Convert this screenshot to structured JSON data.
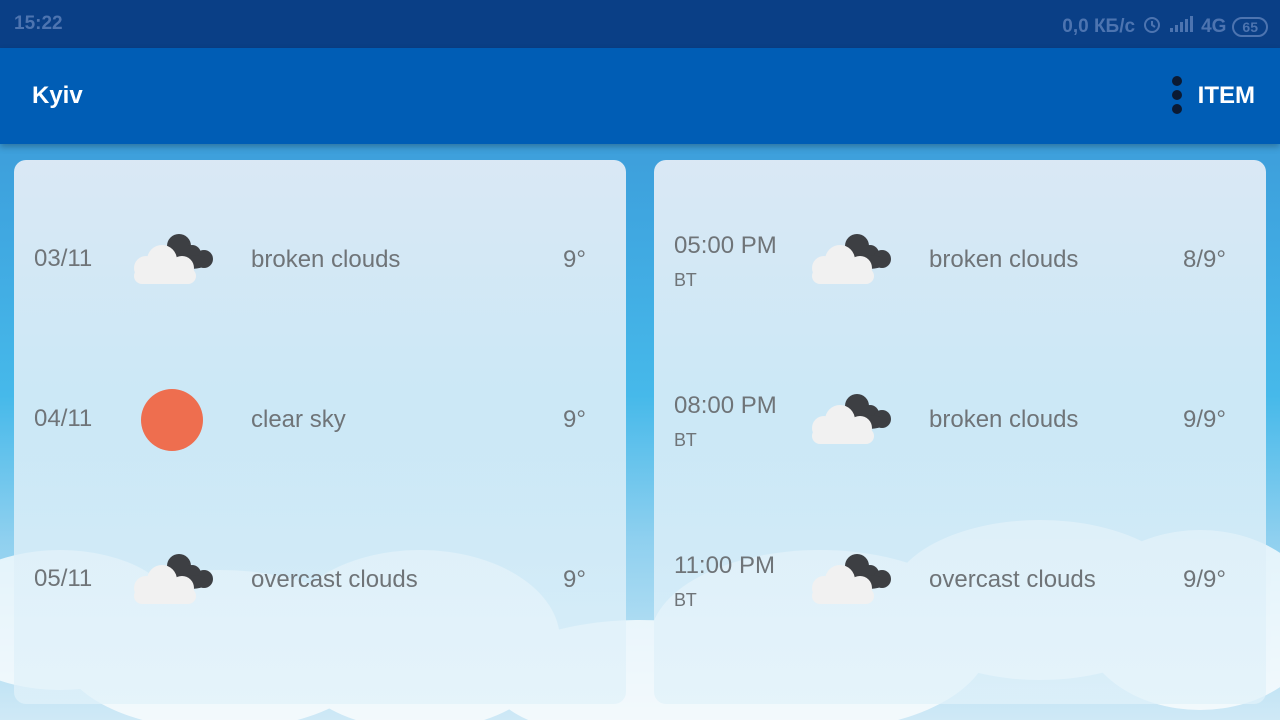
{
  "status_bar": {
    "time": "15:22",
    "net_speed": "0,0 КБ/с",
    "network": "4G",
    "battery": "65"
  },
  "app_bar": {
    "title": "Kyiv",
    "menu_icon": "more-vert-icon",
    "action_label": "ITEM"
  },
  "daily_forecast": [
    {
      "date": "03/11",
      "icon": "broken-clouds-icon",
      "description": "broken clouds",
      "temp": "9°"
    },
    {
      "date": "04/11",
      "icon": "clear-sky-icon",
      "description": "clear sky",
      "temp": "9°"
    },
    {
      "date": "05/11",
      "icon": "overcast-clouds-icon",
      "description": "overcast clouds",
      "temp": "9°"
    }
  ],
  "hourly_forecast": [
    {
      "time": "05:00 PM",
      "day": "ВТ",
      "icon": "broken-clouds-icon",
      "description": "broken clouds",
      "temp": "8/9°"
    },
    {
      "time": "08:00 PM",
      "day": "ВТ",
      "icon": "broken-clouds-icon",
      "description": "broken clouds",
      "temp": "9/9°"
    },
    {
      "time": "11:00 PM",
      "day": "ВТ",
      "icon": "overcast-clouds-icon",
      "description": "overcast clouds",
      "temp": "9/9°"
    }
  ],
  "colors": {
    "status_bar": "#0a3f86",
    "app_bar": "#005db5",
    "sun": "#ee6e4f",
    "text": "#6f7478"
  }
}
